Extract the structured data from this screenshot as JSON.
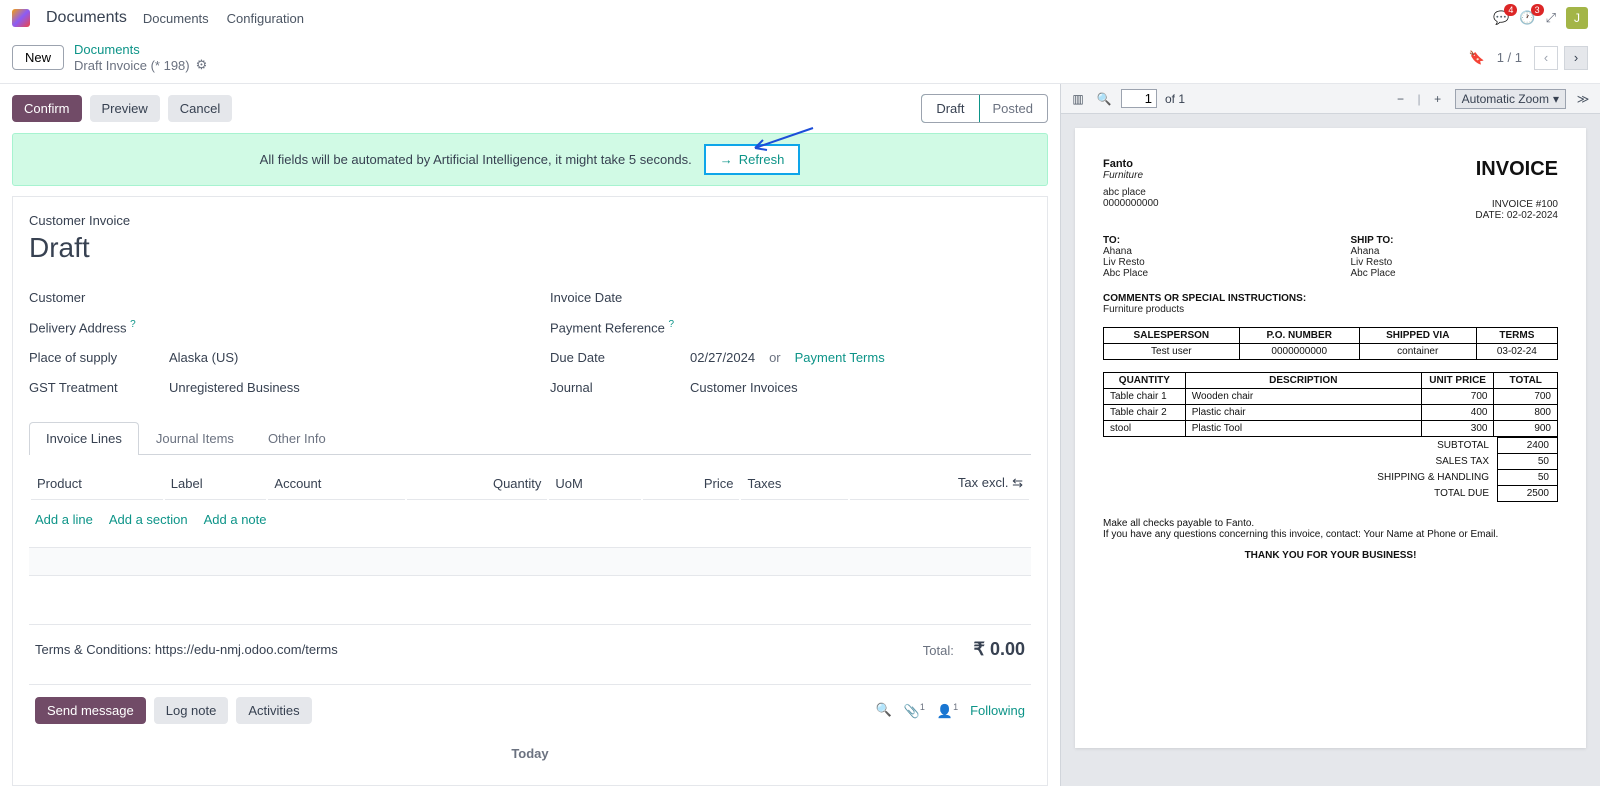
{
  "top": {
    "brand": "Documents",
    "nav": [
      "Documents",
      "Configuration"
    ],
    "msg_badge": "4",
    "act_badge": "3",
    "avatar": "J"
  },
  "subhead": {
    "new": "New",
    "bc_root": "Documents",
    "bc_current": "Draft Invoice (* 198)",
    "counter": "1 / 1"
  },
  "actions": {
    "confirm": "Confirm",
    "preview": "Preview",
    "cancel": "Cancel",
    "status_draft": "Draft",
    "status_posted": "Posted"
  },
  "banner": {
    "text": "All fields will be automated by Artificial Intelligence, it might take 5 seconds.",
    "refresh": "Refresh"
  },
  "form": {
    "section": "Customer Invoice",
    "title": "Draft",
    "labels": {
      "customer": "Customer",
      "delivery": "Delivery Address",
      "place": "Place of supply",
      "gst": "GST Treatment",
      "invdate": "Invoice Date",
      "payref": "Payment Reference",
      "due": "Due Date",
      "journal": "Journal"
    },
    "values": {
      "place": "Alaska (US)",
      "gst": "Unregistered Business",
      "due": "02/27/2024",
      "or": "or",
      "payment_terms": "Payment Terms",
      "journal": "Customer Invoices"
    }
  },
  "tabs": [
    "Invoice Lines",
    "Journal Items",
    "Other Info"
  ],
  "columns": {
    "product": "Product",
    "label": "Label",
    "account": "Account",
    "quantity": "Quantity",
    "uom": "UoM",
    "price": "Price",
    "taxes": "Taxes",
    "taxexcl": "Tax excl."
  },
  "add": {
    "line": "Add a line",
    "section": "Add a section",
    "note": "Add a note"
  },
  "terms": "Terms & Conditions: https://edu-nmj.odoo.com/terms",
  "total": {
    "label": "Total:",
    "value": "₹ 0.00"
  },
  "chatter": {
    "send": "Send message",
    "log": "Log note",
    "activities": "Activities",
    "following": "Following",
    "today": "Today",
    "attach_count": "1",
    "follow_count": "1"
  },
  "pdftb": {
    "page": "1",
    "of": "of 1",
    "zoom": "Automatic Zoom"
  },
  "invoice": {
    "company": "Fanto",
    "subtitle": "Furniture",
    "addr1": "abc place",
    "addr2": "0000000000",
    "title": "INVOICE",
    "invno": "INVOICE #100",
    "date": "DATE: 02-02-2024",
    "to": {
      "h": "TO:",
      "l1": "Ahana",
      "l2": "Liv Resto",
      "l3": "Abc Place"
    },
    "ship": {
      "h": "SHIP TO:",
      "l1": "Ahana",
      "l2": "Liv Resto",
      "l3": "Abc Place"
    },
    "comments_h": "COMMENTS OR SPECIAL INSTRUCTIONS:",
    "comments": "Furniture products",
    "order": {
      "h": [
        "SALESPERSON",
        "P.O. NUMBER",
        "SHIPPED VIA",
        "TERMS"
      ],
      "r": [
        "Test user",
        "0000000000",
        "container",
        "03-02-24"
      ]
    },
    "lines": {
      "h": [
        "QUANTITY",
        "DESCRIPTION",
        "UNIT PRICE",
        "TOTAL"
      ],
      "rows": [
        [
          "Table chair 1",
          "Wooden chair",
          "700",
          "700"
        ],
        [
          "Table chair 2",
          "Plastic chair",
          "400",
          "800"
        ],
        [
          "stool",
          "Plastic Tool",
          "300",
          "900"
        ]
      ]
    },
    "totals": [
      [
        "SUBTOTAL",
        "2400"
      ],
      [
        "SALES TAX",
        "50"
      ],
      [
        "SHIPPING & HANDLING",
        "50"
      ],
      [
        "TOTAL DUE",
        "2500"
      ]
    ],
    "payable": "Make all checks payable to Fanto.",
    "questions": "If you have any questions concerning this invoice, contact: Your Name at Phone or Email.",
    "thanks": "THANK YOU FOR YOUR BUSINESS!"
  }
}
